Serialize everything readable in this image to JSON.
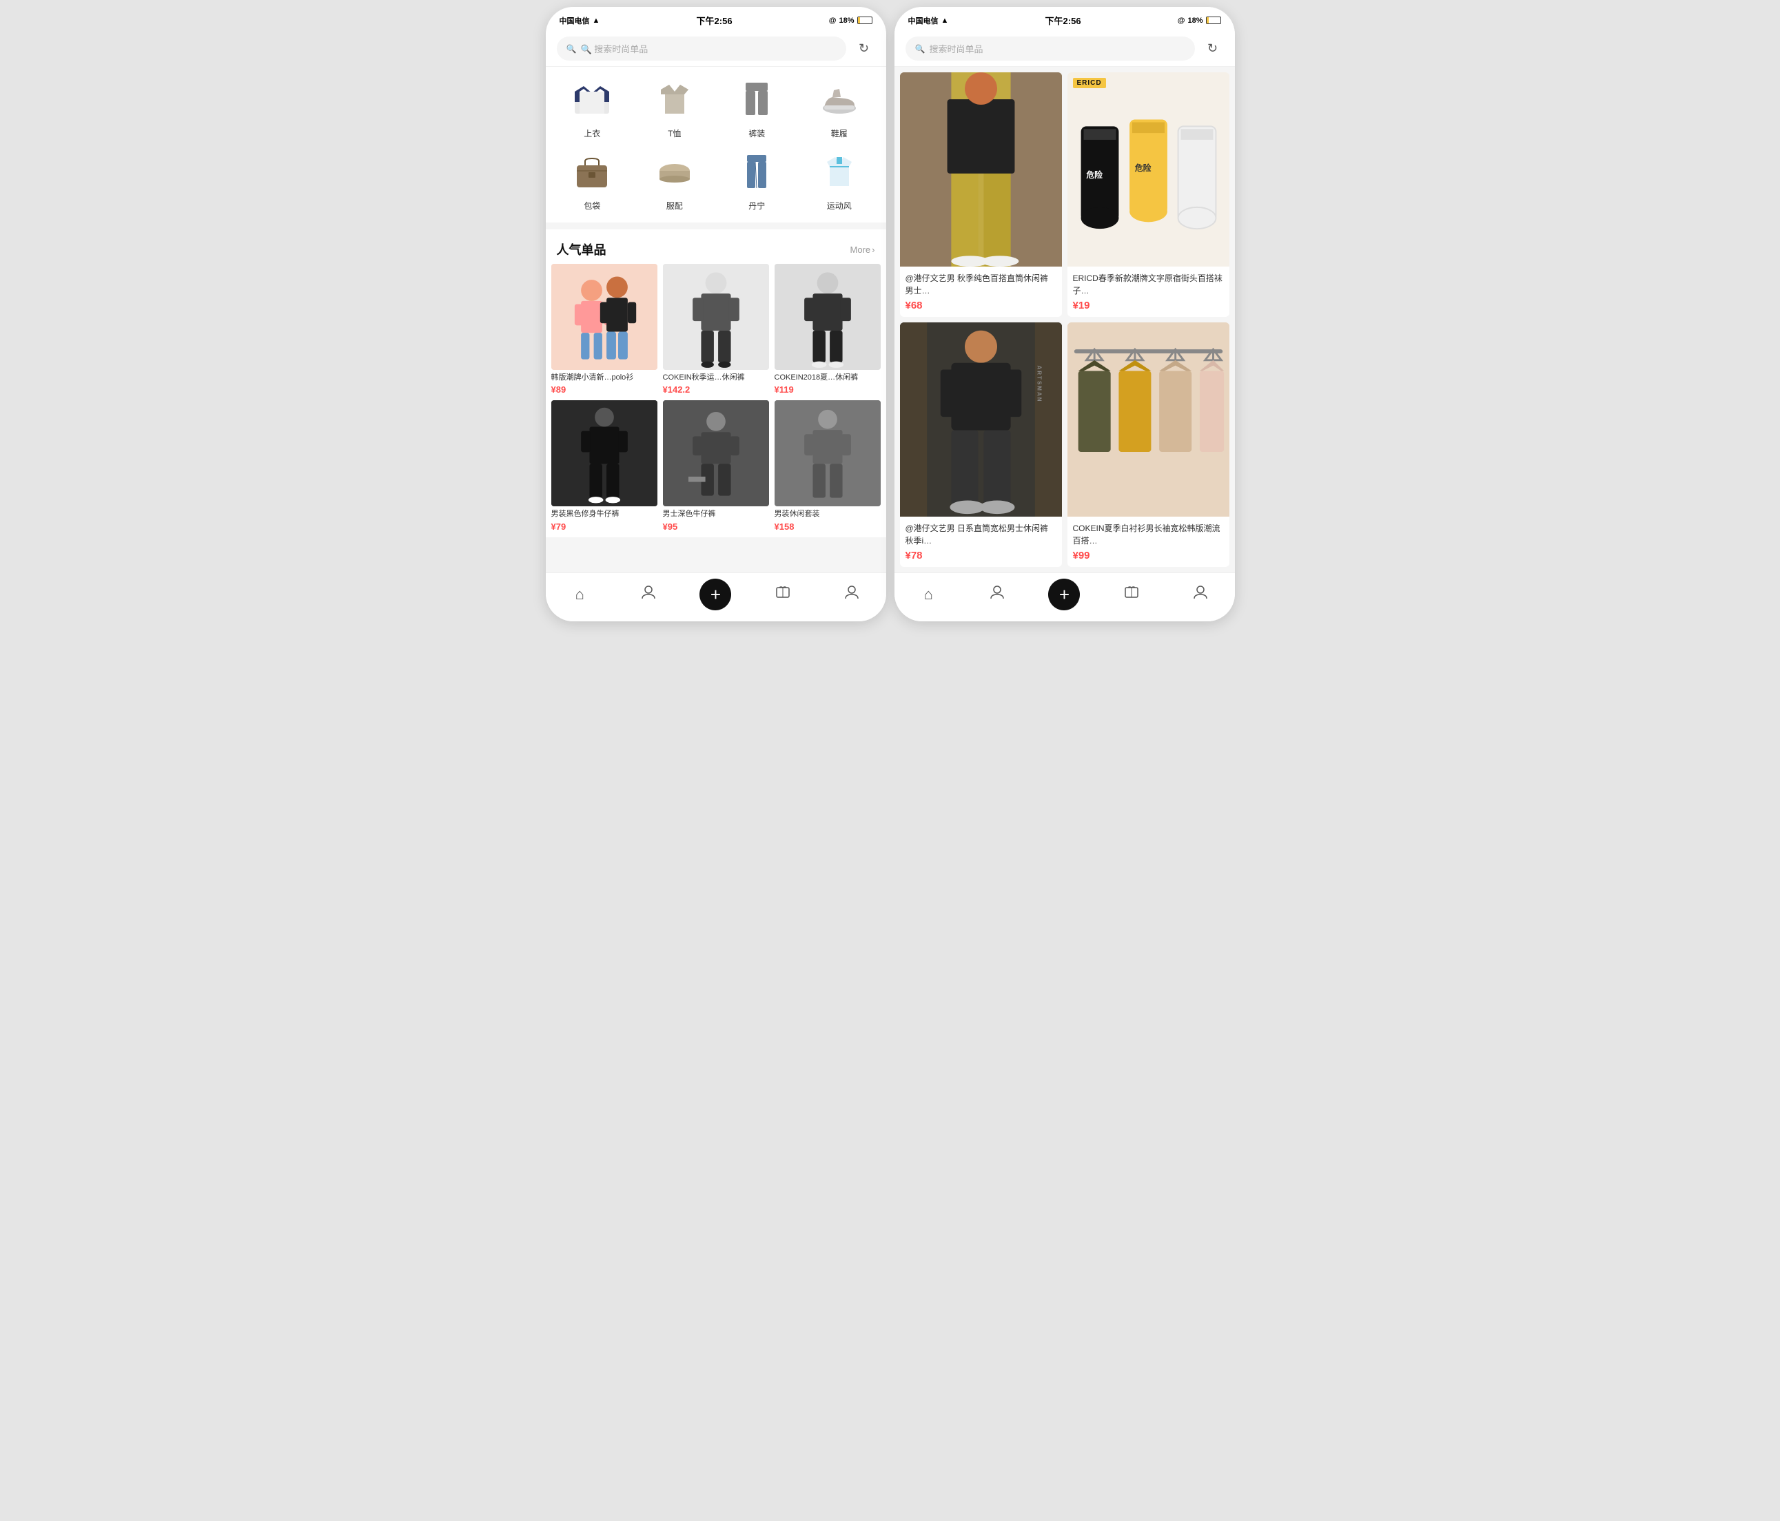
{
  "phones": {
    "left": {
      "statusBar": {
        "carrier": "中国电信",
        "wifi": "📶",
        "time": "下午2:56",
        "battery": "18%"
      },
      "search": {
        "placeholder": "🔍 搜索时尚单品"
      },
      "categories": [
        {
          "id": "tops",
          "label": "上衣",
          "emoji": "👕",
          "bg": "#f0f0f0"
        },
        {
          "id": "tshirt",
          "label": "T恤",
          "emoji": "👕",
          "bg": "#f0f0f0"
        },
        {
          "id": "pants",
          "label": "裤装",
          "emoji": "👖",
          "bg": "#f0f0f0"
        },
        {
          "id": "shoes",
          "label": "鞋履",
          "emoji": "👟",
          "bg": "#f0f0f0"
        },
        {
          "id": "bag",
          "label": "包袋",
          "emoji": "🎒",
          "bg": "#f0f0f0"
        },
        {
          "id": "accessories",
          "label": "服配",
          "emoji": "🧢",
          "bg": "#f0f0f0"
        },
        {
          "id": "denim",
          "label": "丹宁",
          "emoji": "👖",
          "bg": "#f0f0f0"
        },
        {
          "id": "sport",
          "label": "运动风",
          "emoji": "🧥",
          "bg": "#f0f0f0"
        }
      ],
      "popularSection": {
        "title": "人气单品",
        "moreLabel": "More",
        "moreArrow": "›"
      },
      "products": [
        {
          "id": 1,
          "name": "韩版潮牌小清新…polo衫",
          "price": "¥89",
          "emoji": "👫",
          "bg": "#f8d7c8"
        },
        {
          "id": 2,
          "name": "COKEIN秋季运…休闲裤",
          "price": "¥142.2",
          "emoji": "🧍",
          "bg": "#e8e8e8"
        },
        {
          "id": 3,
          "name": "COKEIN2018夏…休闲裤",
          "price": "¥119",
          "emoji": "🧍",
          "bg": "#ddd"
        },
        {
          "id": 4,
          "name": "男装黑色修身牛仔裤",
          "price": "¥79",
          "emoji": "🧍",
          "bg": "#333"
        },
        {
          "id": 5,
          "name": "男士深色牛仔裤",
          "price": "¥95",
          "emoji": "🧍",
          "bg": "#555"
        },
        {
          "id": 6,
          "name": "男装休闲套装",
          "price": "¥158",
          "emoji": "🧍",
          "bg": "#888"
        }
      ],
      "bottomNav": [
        {
          "id": "home",
          "icon": "⌂",
          "label": ""
        },
        {
          "id": "user",
          "icon": "👤",
          "label": ""
        },
        {
          "id": "add",
          "icon": "+",
          "label": "",
          "isAdd": true
        },
        {
          "id": "wardrobe",
          "icon": "👔",
          "label": ""
        },
        {
          "id": "profile",
          "icon": "👤",
          "label": ""
        }
      ]
    },
    "right": {
      "statusBar": {
        "carrier": "中国电信",
        "wifi": "📶",
        "time": "下午2:56",
        "battery": "18%"
      },
      "search": {
        "placeholder": "🔍 搜索时尚单品"
      },
      "products": [
        {
          "id": 1,
          "name": "@港仔文艺男 秋季纯色百搭直筒休闲裤男士…",
          "price": "¥68",
          "bg": "#c8b88a",
          "emoji": "🧍",
          "hasTag": false
        },
        {
          "id": 2,
          "name": "ERICD春季新款潮牌文字原宿街头百搭袜子…",
          "price": "¥19",
          "bg": "#f5f0e8",
          "emoji": "🧦",
          "hasTag": true,
          "tagLabel": "ERICD"
        },
        {
          "id": 3,
          "name": "@港仔文艺男 日系直筒宽松男士休闲裤秋季i…",
          "price": "¥78",
          "bg": "#444",
          "emoji": "🧍",
          "hasTag": false,
          "sideLabel": "ARTSMAN"
        },
        {
          "id": 4,
          "name": "COKEIN夏季白衬衫男长袖宽松韩版潮流百搭…",
          "price": "¥99",
          "bg": "#e8d5c0",
          "emoji": "👔",
          "hasTag": false
        }
      ],
      "bottomNav": [
        {
          "id": "home",
          "icon": "⌂",
          "label": ""
        },
        {
          "id": "user",
          "icon": "👤",
          "label": ""
        },
        {
          "id": "add",
          "icon": "+",
          "label": "",
          "isAdd": true
        },
        {
          "id": "wardrobe",
          "icon": "👔",
          "label": ""
        },
        {
          "id": "profile",
          "icon": "👤",
          "label": ""
        }
      ]
    }
  }
}
